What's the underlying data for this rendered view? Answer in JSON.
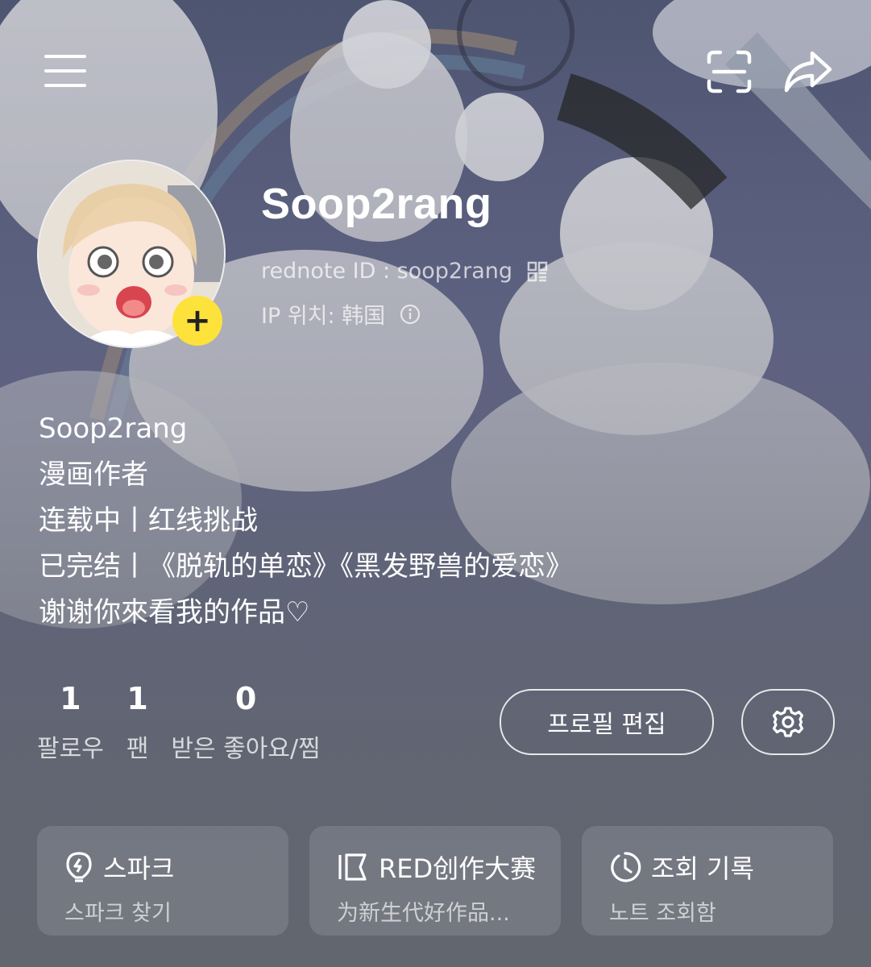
{
  "header": {
    "menu_icon": "hamburger-menu-icon",
    "scan_icon": "scan-icon",
    "share_icon": "share-arrow-icon"
  },
  "profile": {
    "username": "Soop2rang",
    "rednote_id": "rednote ID : soop2rang",
    "ip_location": "IP 위치: 韩国",
    "add_badge": "+"
  },
  "bio": {
    "lines": [
      "Soop2rang",
      "漫画作者",
      "连载中丨红线挑战",
      "已完结丨《脱轨的单恋》《黑发野兽的爱恋》",
      "谢谢你來看我的作品♡"
    ]
  },
  "stats": [
    {
      "value": "1",
      "label": "팔로우"
    },
    {
      "value": "1",
      "label": "팬"
    },
    {
      "value": "0",
      "label": "받은 좋아요/찜"
    }
  ],
  "actions": {
    "edit_profile_label": "프로필 편집",
    "settings_icon": "gear-icon"
  },
  "cards": [
    {
      "title": "스파크",
      "subtitle": "스파크 찾기",
      "icon": "lightbulb-icon"
    },
    {
      "title": "RED创作大赛",
      "subtitle": "为新生代好作品...",
      "icon": "flag-icon"
    },
    {
      "title": "조회 기록",
      "subtitle": "노트 조회함",
      "icon": "history-clock-icon"
    }
  ],
  "colors": {
    "badge_yellow": "#fde23b"
  }
}
